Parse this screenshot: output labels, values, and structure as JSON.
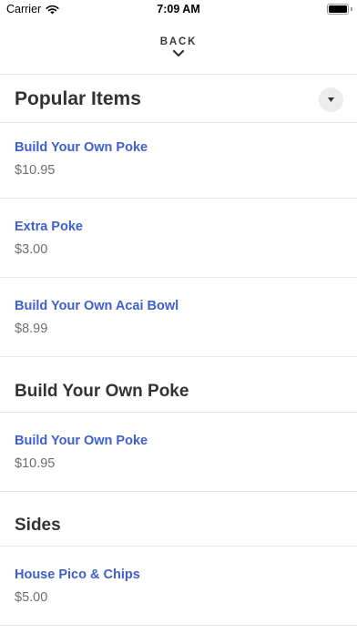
{
  "status": {
    "carrier": "Carrier",
    "time": "7:09 AM"
  },
  "nav": {
    "back_label": "BACK"
  },
  "sections": [
    {
      "title": "Popular Items",
      "items": [
        {
          "name": "Build Your Own Poke",
          "price": "$10.95"
        },
        {
          "name": "Extra Poke",
          "price": "$3.00"
        },
        {
          "name": "Build Your Own Acai Bowl",
          "price": "$8.99"
        }
      ]
    },
    {
      "title": "Build Your Own Poke",
      "items": [
        {
          "name": "Build Your Own Poke",
          "price": "$10.95"
        }
      ]
    },
    {
      "title": "Sides",
      "items": [
        {
          "name": "House Pico & Chips",
          "price": "$5.00"
        }
      ]
    }
  ],
  "colors": {
    "item_link": "#3f5fd0",
    "price": "#6e6e6e",
    "divider": "#e8e8e8"
  },
  "icons": {
    "dropdown": "caret-down-icon",
    "back": "chevron-down-icon",
    "wifi": "wifi-icon",
    "battery": "battery-icon"
  }
}
